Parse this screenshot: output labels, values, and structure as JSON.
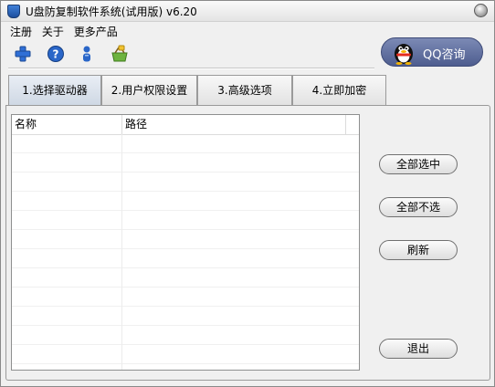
{
  "window": {
    "title": "U盘防复制软件系统(试用版) v6.20"
  },
  "menu": {
    "items": [
      "注册",
      "关于",
      "更多产品"
    ]
  },
  "toolbar": {
    "icons": [
      "plus-icon",
      "help-icon",
      "user-icon",
      "basket-icon"
    ]
  },
  "qq": {
    "label": "QQ咨询"
  },
  "tabs": [
    "1.选择驱动器",
    "2.用户权限设置",
    "3.高级选项",
    "4.立即加密"
  ],
  "active_tab": 0,
  "list": {
    "columns": [
      "名称",
      "路径"
    ],
    "rows": []
  },
  "buttons": {
    "select_all": "全部选中",
    "select_none": "全部不选",
    "refresh": "刷新",
    "exit": "退出"
  },
  "colors": {
    "qq_button": "#5a6899",
    "active_tab": "#d4dce8"
  }
}
